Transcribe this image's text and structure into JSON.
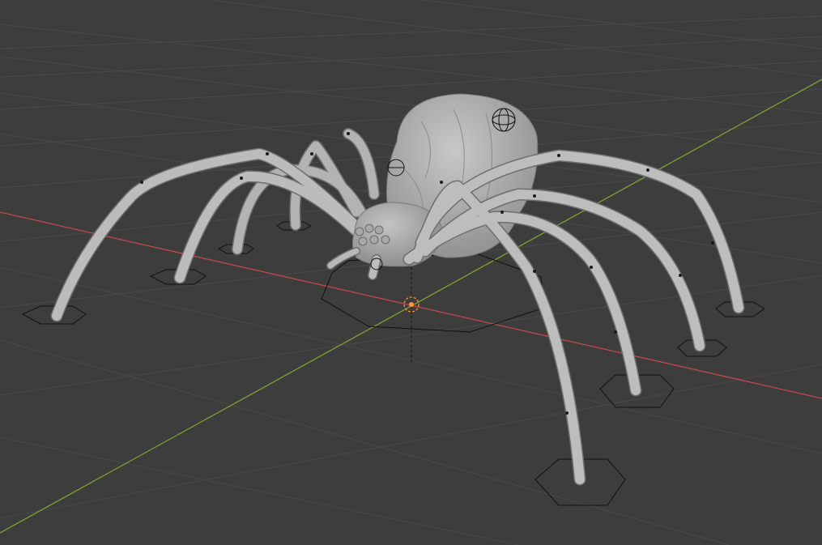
{
  "viewport": {
    "view": "3D Viewport",
    "background_color": "#3d3d3d",
    "grid_color": "#4a4a4a",
    "axis_x_color": "#c0484f",
    "axis_y_color": "#7ea12c",
    "mesh_color": "#b8b8b8",
    "control_color": "#111111",
    "origin_color": "#ff9a2e"
  },
  "scene": {
    "objects": [
      {
        "name": "spider-mesh",
        "type": "mesh"
      },
      {
        "name": "spider-rig",
        "type": "armature"
      }
    ],
    "foot_controls": 8,
    "root_control": "root-octagon-control",
    "eye_targets": 2
  }
}
